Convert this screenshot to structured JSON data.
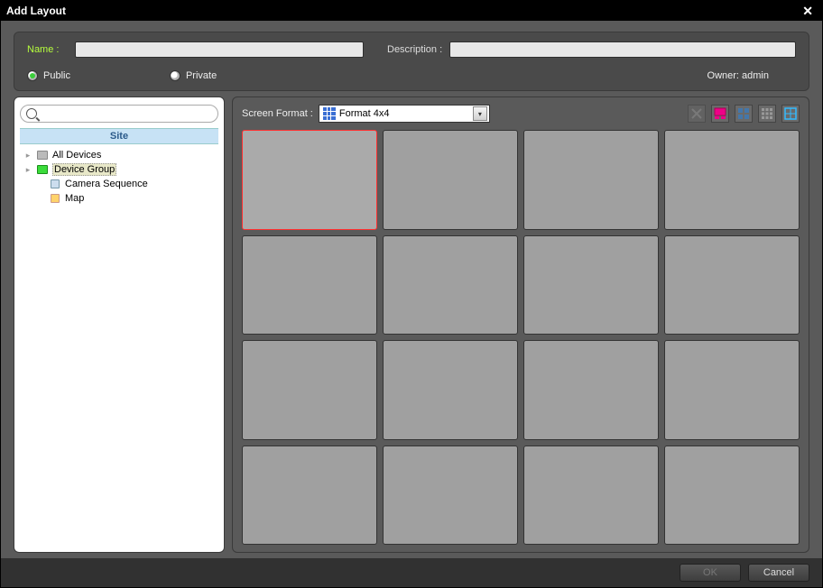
{
  "title": "Add Layout",
  "header": {
    "name_label": "Name :",
    "desc_label": "Description :",
    "name_value": "",
    "desc_value": "",
    "public_label": "Public",
    "private_label": "Private",
    "visibility": "public",
    "owner_label": "Owner: admin"
  },
  "sidebar": {
    "search_placeholder": "",
    "site_header": "Site",
    "items": [
      {
        "label": "All Devices",
        "expandable": true,
        "selected": false,
        "icon": "devices"
      },
      {
        "label": "Device Group",
        "expandable": true,
        "selected": true,
        "icon": "group"
      },
      {
        "label": "Camera Sequence",
        "expandable": false,
        "selected": false,
        "icon": "sequence"
      },
      {
        "label": "Map",
        "expandable": false,
        "selected": false,
        "icon": "map"
      }
    ]
  },
  "main": {
    "screen_format_label": "Screen Format :",
    "screen_format_value": "Format 4x4",
    "grid": {
      "rows": 4,
      "cols": 4,
      "selected_index": 0
    }
  },
  "footer": {
    "ok_label": "OK",
    "cancel_label": "Cancel",
    "ok_enabled": false
  }
}
